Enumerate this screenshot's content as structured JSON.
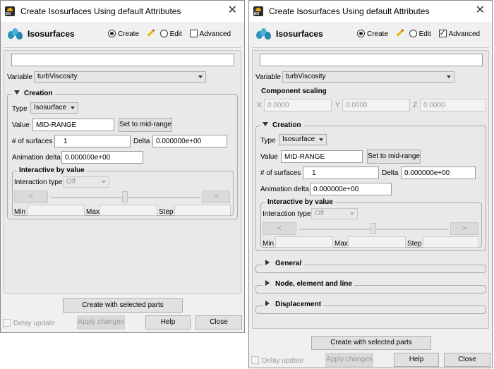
{
  "window_title": "Create Isosurfaces Using default Attributes",
  "header": {
    "label": "Isosurfaces",
    "create": "Create",
    "edit": "Edit",
    "advanced": "Advanced"
  },
  "variable": {
    "label": "Variable",
    "value": "turbViscosity"
  },
  "component_scaling": {
    "title": "Component scaling",
    "x_label": "X",
    "x_value": "0.0000",
    "y_label": "Y",
    "y_value": "0.0000",
    "z_label": "Z",
    "z_value": "0.0000"
  },
  "creation": {
    "title": "Creation",
    "type_label": "Type",
    "type_value": "Isosurface",
    "value_label": "Value",
    "value_value": "MID-RANGE",
    "set_mid_range": "Set to mid-range",
    "num_surfaces_label": "# of surfaces",
    "num_surfaces_value": "1",
    "delta_label": "Delta",
    "delta_value": "0.000000e+00",
    "anim_delta_label": "Animation delta",
    "anim_delta_value": "0.000000e+00"
  },
  "interactive": {
    "title": "Interactive by value",
    "type_label": "Interaction type",
    "type_value": "Off",
    "prev": "<",
    "next": ">",
    "min_label": "Min",
    "max_label": "Max",
    "step_label": "Step"
  },
  "sections": {
    "general": "General",
    "node": "Node, element and line",
    "displacement": "Displacement"
  },
  "footer": {
    "create_parts": "Create with selected parts",
    "delay_update": "Delay update",
    "apply": "Apply changes",
    "help": "Help",
    "close": "Close"
  },
  "icons": {
    "close": "close-icon",
    "app": "ensight-app-icon",
    "isosurface": "isosurface-drops-icon",
    "edit": "pencil-icon"
  }
}
